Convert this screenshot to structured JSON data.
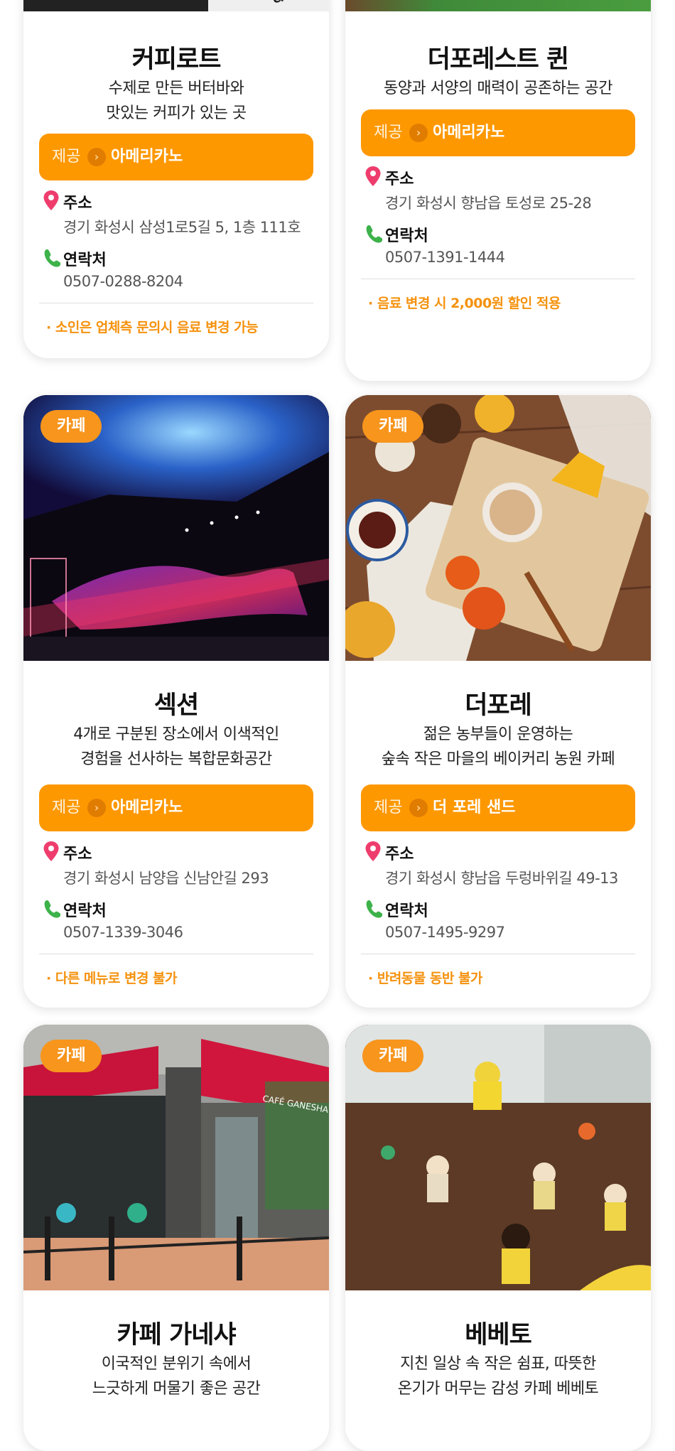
{
  "colors": {
    "accent": "#fe9800",
    "note": "#f5920e",
    "badge": "#f7951d"
  },
  "labels": {
    "offer_prefix": "제공",
    "address": "주소",
    "contact": "연락처",
    "category": "카페"
  },
  "cards": [
    {
      "title": "커피로트",
      "desc1": "수제로 만든 버터바와",
      "desc2": "맛있는 커피가 있는 곳",
      "offer": "아메리카노",
      "address": "경기 화성시 삼성1로5길 5, 1층 111호",
      "phone": "0507-0288-8204",
      "note": "· 소인은 업체측 문의시 음료 변경 가능",
      "photo_text": "atter"
    },
    {
      "title": "더포레스트 퀸",
      "desc1": "동양과 서양의 매력이 공존하는 공간",
      "offer": "아메리카노",
      "address": "경기 화성시 향남읍 토성로 25-28",
      "phone": "0507-1391-1444",
      "note": "· 음료 변경 시 2,000원 할인 적용"
    },
    {
      "title": "섹션",
      "desc1": "4개로 구분된 장소에서 이색적인",
      "desc2": "경험을 선사하는 복합문화공간",
      "offer": "아메리카노",
      "address": "경기 화성시 남양읍 신남안길 293",
      "phone": "0507-1339-3046",
      "note": "· 다른 메뉴로 변경 불가"
    },
    {
      "title": "더포레",
      "desc1": "젊은 농부들이 운영하는",
      "desc2": "숲속 작은 마을의 베이커리 농원 카페",
      "offer": "더 포레 샌드",
      "address": "경기 화성시 향남읍 두렁바위길 49-13",
      "phone": "0507-1495-9297",
      "note": "· 반려동물 동반 불가"
    },
    {
      "title": "카페 가네샤",
      "desc1": "이국적인 분위기 속에서",
      "desc2": "느긋하게 머물기 좋은 공간",
      "photo_text": "CAFÉ GANESHA"
    },
    {
      "title": "베베토",
      "desc1": "지친 일상 속 작은 쉼표, 따뜻한",
      "desc2": "온기가 머무는 감성 카페 베베토"
    }
  ]
}
